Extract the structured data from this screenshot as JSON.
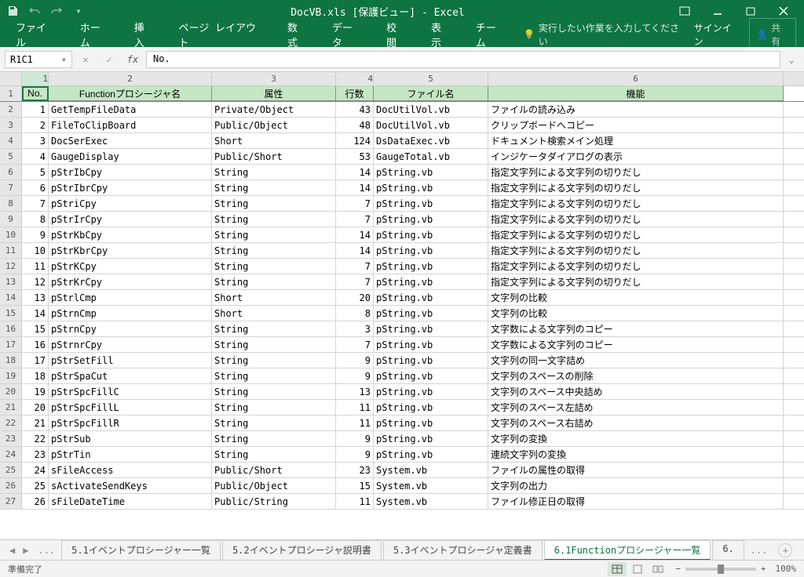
{
  "title": "DocVB.xls  [保護ビュー] - Excel",
  "qat": {
    "save": "保存",
    "undo": "元に戻す",
    "redo": "やり直し"
  },
  "ribbon": {
    "tabs": [
      "ファイル",
      "ホーム",
      "挿入",
      "ページ レイアウト",
      "数式",
      "データ",
      "校閲",
      "表示",
      "チーム"
    ],
    "tell": "実行したい作業を入力してください",
    "signin": "サインイン",
    "share": "共有"
  },
  "formula": {
    "namebox": "R1C1",
    "value": "No."
  },
  "colNumbers": [
    "1",
    "2",
    "3",
    "4",
    "5",
    "6"
  ],
  "headers": {
    "c1": "No.",
    "c2": "Functionプロシージャ名",
    "c3": "属性",
    "c4": "行数",
    "c5": "ファイル名",
    "c6": "機能"
  },
  "rows": [
    {
      "n": "1",
      "fn": "GetTempFileData",
      "attr": "Private/Object",
      "lines": "43",
      "file": "DocUtilVol.vb",
      "desc": "ファイルの読み込み"
    },
    {
      "n": "2",
      "fn": "FileToClipBoard",
      "attr": "Public/Object",
      "lines": "48",
      "file": "DocUtilVol.vb",
      "desc": "クリップボードへコピー"
    },
    {
      "n": "3",
      "fn": "DocSerExec",
      "attr": "Short",
      "lines": "124",
      "file": "DsDataExec.vb",
      "desc": "ドキュメント検索メイン処理"
    },
    {
      "n": "4",
      "fn": "GaugeDisplay",
      "attr": "Public/Short",
      "lines": "53",
      "file": "GaugeTotal.vb",
      "desc": "インジケータダイアログの表示"
    },
    {
      "n": "5",
      "fn": "pStrIbCpy",
      "attr": "String",
      "lines": "14",
      "file": "pString.vb",
      "desc": "指定文字列による文字列の切りだし"
    },
    {
      "n": "6",
      "fn": "pStrIbrCpy",
      "attr": "String",
      "lines": "14",
      "file": "pString.vb",
      "desc": "指定文字列による文字列の切りだし"
    },
    {
      "n": "7",
      "fn": "pStriCpy",
      "attr": "String",
      "lines": "7",
      "file": "pString.vb",
      "desc": "指定文字列による文字列の切りだし"
    },
    {
      "n": "8",
      "fn": "pStrIrCpy",
      "attr": "String",
      "lines": "7",
      "file": "pString.vb",
      "desc": "指定文字列による文字列の切りだし"
    },
    {
      "n": "9",
      "fn": "pStrKbCpy",
      "attr": "String",
      "lines": "14",
      "file": "pString.vb",
      "desc": "指定文字列による文字列の切りだし"
    },
    {
      "n": "10",
      "fn": "pStrKbrCpy",
      "attr": "String",
      "lines": "14",
      "file": "pString.vb",
      "desc": "指定文字列による文字列の切りだし"
    },
    {
      "n": "11",
      "fn": "pStrKCpy",
      "attr": "String",
      "lines": "7",
      "file": "pString.vb",
      "desc": "指定文字列による文字列の切りだし"
    },
    {
      "n": "12",
      "fn": "pStrKrCpy",
      "attr": "String",
      "lines": "7",
      "file": "pString.vb",
      "desc": "指定文字列による文字列の切りだし"
    },
    {
      "n": "13",
      "fn": "pStrlCmp",
      "attr": "Short",
      "lines": "20",
      "file": "pString.vb",
      "desc": "文字列の比較"
    },
    {
      "n": "14",
      "fn": "pStrnCmp",
      "attr": "Short",
      "lines": "8",
      "file": "pString.vb",
      "desc": "文字列の比較"
    },
    {
      "n": "15",
      "fn": "pStrnCpy",
      "attr": "String",
      "lines": "3",
      "file": "pString.vb",
      "desc": "文字数による文字列のコピー"
    },
    {
      "n": "16",
      "fn": "pStrnrCpy",
      "attr": "String",
      "lines": "7",
      "file": "pString.vb",
      "desc": "文字数による文字列のコピー"
    },
    {
      "n": "17",
      "fn": "pStrSetFill",
      "attr": "String",
      "lines": "9",
      "file": "pString.vb",
      "desc": "文字列の同一文字詰め"
    },
    {
      "n": "18",
      "fn": "pStrSpaCut",
      "attr": "String",
      "lines": "9",
      "file": "pString.vb",
      "desc": "文字列のスペースの削除"
    },
    {
      "n": "19",
      "fn": "pStrSpcFillC",
      "attr": "String",
      "lines": "13",
      "file": "pString.vb",
      "desc": "文字列のスペース中央詰め"
    },
    {
      "n": "20",
      "fn": "pStrSpcFillL",
      "attr": "String",
      "lines": "11",
      "file": "pString.vb",
      "desc": "文字列のスペース左詰め"
    },
    {
      "n": "21",
      "fn": "pStrSpcFillR",
      "attr": "String",
      "lines": "11",
      "file": "pString.vb",
      "desc": "文字列のスペース右詰め"
    },
    {
      "n": "22",
      "fn": "pStrSub",
      "attr": "String",
      "lines": "9",
      "file": "pString.vb",
      "desc": "文字列の変換"
    },
    {
      "n": "23",
      "fn": "pStrTin",
      "attr": "String",
      "lines": "9",
      "file": "pString.vb",
      "desc": "連続文字列の変換"
    },
    {
      "n": "24",
      "fn": "sFileAccess",
      "attr": "Public/Short",
      "lines": "23",
      "file": "System.vb",
      "desc": "ファイルの属性の取得"
    },
    {
      "n": "25",
      "fn": "sActivateSendKeys",
      "attr": "Public/Object",
      "lines": "15",
      "file": "System.vb",
      "desc": "文字列の出力"
    },
    {
      "n": "26",
      "fn": "sFileDateTime",
      "attr": "Public/String",
      "lines": "11",
      "file": "System.vb",
      "desc": "ファイル修正日の取得"
    }
  ],
  "sheets": {
    "list": [
      "5.1イベントプロシージャー一覧",
      "5.2イベントプロシージャ説明書",
      "5.3イベントプロシージャ定義書",
      "6.1Functionプロシージャー一覧",
      "6."
    ],
    "active": 3,
    "more": "..."
  },
  "status": {
    "ready": "準備完了",
    "zoom": "100%"
  }
}
